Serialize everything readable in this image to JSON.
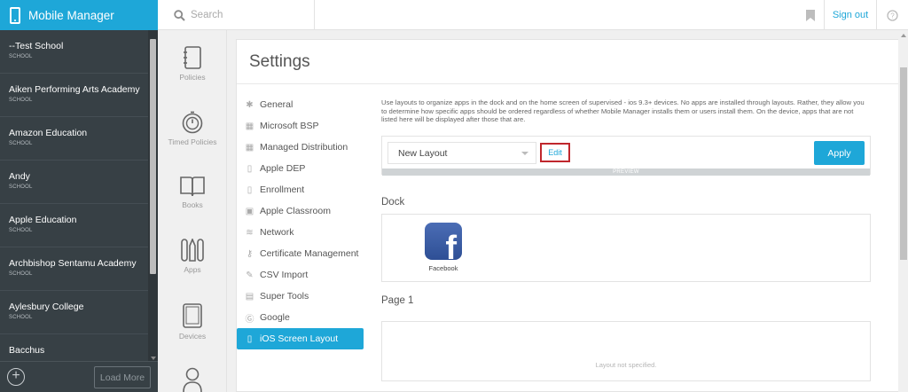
{
  "app": {
    "title": "Mobile Manager"
  },
  "header": {
    "search_placeholder": "Search",
    "signout_label": "Sign out",
    "bookmark_icon": "bookmark-icon",
    "help_icon": "help-icon"
  },
  "schools": [
    {
      "name": "--Test School",
      "kind": "SCHOOL"
    },
    {
      "name": "Aiken Performing Arts Academy",
      "kind": "SCHOOL"
    },
    {
      "name": "Amazon Education",
      "kind": "SCHOOL"
    },
    {
      "name": "Andy",
      "kind": "SCHOOL"
    },
    {
      "name": "Apple Education",
      "kind": "SCHOOL"
    },
    {
      "name": "Archbishop Sentamu Academy",
      "kind": "SCHOOL"
    },
    {
      "name": "Aylesbury College",
      "kind": "SCHOOL"
    },
    {
      "name": "Bacchus",
      "kind": ""
    }
  ],
  "sidebar_footer": {
    "load_more_label": "Load More"
  },
  "nav": [
    {
      "label": "Policies",
      "icon": "notebook-icon"
    },
    {
      "label": "Timed Policies",
      "icon": "timer-icon"
    },
    {
      "label": "Books",
      "icon": "book-icon"
    },
    {
      "label": "Apps",
      "icon": "apps-icon"
    },
    {
      "label": "Devices",
      "icon": "tablet-icon"
    },
    {
      "label": "",
      "icon": "user-icon"
    }
  ],
  "settings": {
    "title": "Settings",
    "menu": [
      {
        "label": "General",
        "icon": "gear-icon"
      },
      {
        "label": "Microsoft BSP",
        "icon": "windows-icon"
      },
      {
        "label": "Managed Distribution",
        "icon": "grid-icon"
      },
      {
        "label": "Apple DEP",
        "icon": "tablet-icon"
      },
      {
        "label": "Enrollment",
        "icon": "tablet-icon"
      },
      {
        "label": "Apple Classroom",
        "icon": "image-icon"
      },
      {
        "label": "Network",
        "icon": "wifi-icon"
      },
      {
        "label": "Certificate Management",
        "icon": "key-icon"
      },
      {
        "label": "CSV Import",
        "icon": "edit-icon"
      },
      {
        "label": "Super Tools",
        "icon": "toolbox-icon"
      },
      {
        "label": "Google",
        "icon": "google-icon"
      },
      {
        "label": "iOS Screen Layout",
        "icon": "tablet-icon",
        "active": true
      }
    ]
  },
  "layout": {
    "description": "Use layouts to organize apps in the dock and on the home screen of supervised - ios 9.3+ devices. No apps are installed through layouts. Rather, they allow you to determine how specific apps should be ordered regardless of whether Mobile Manager installs them or users install them. On the device, apps that are not listed here will be displayed after those that are.",
    "selected_layout": "New Layout",
    "edit_label": "Edit",
    "apply_label": "Apply",
    "preview_label": "PREVIEW",
    "dock_title": "Dock",
    "dock_apps": [
      {
        "name": "Facebook",
        "icon": "facebook-icon"
      }
    ],
    "page1_title": "Page 1",
    "page1_empty": "Layout not specified."
  },
  "colors": {
    "accent": "#1ea7d8",
    "sidebar": "#374045",
    "edit_highlight": "#c0272d"
  }
}
